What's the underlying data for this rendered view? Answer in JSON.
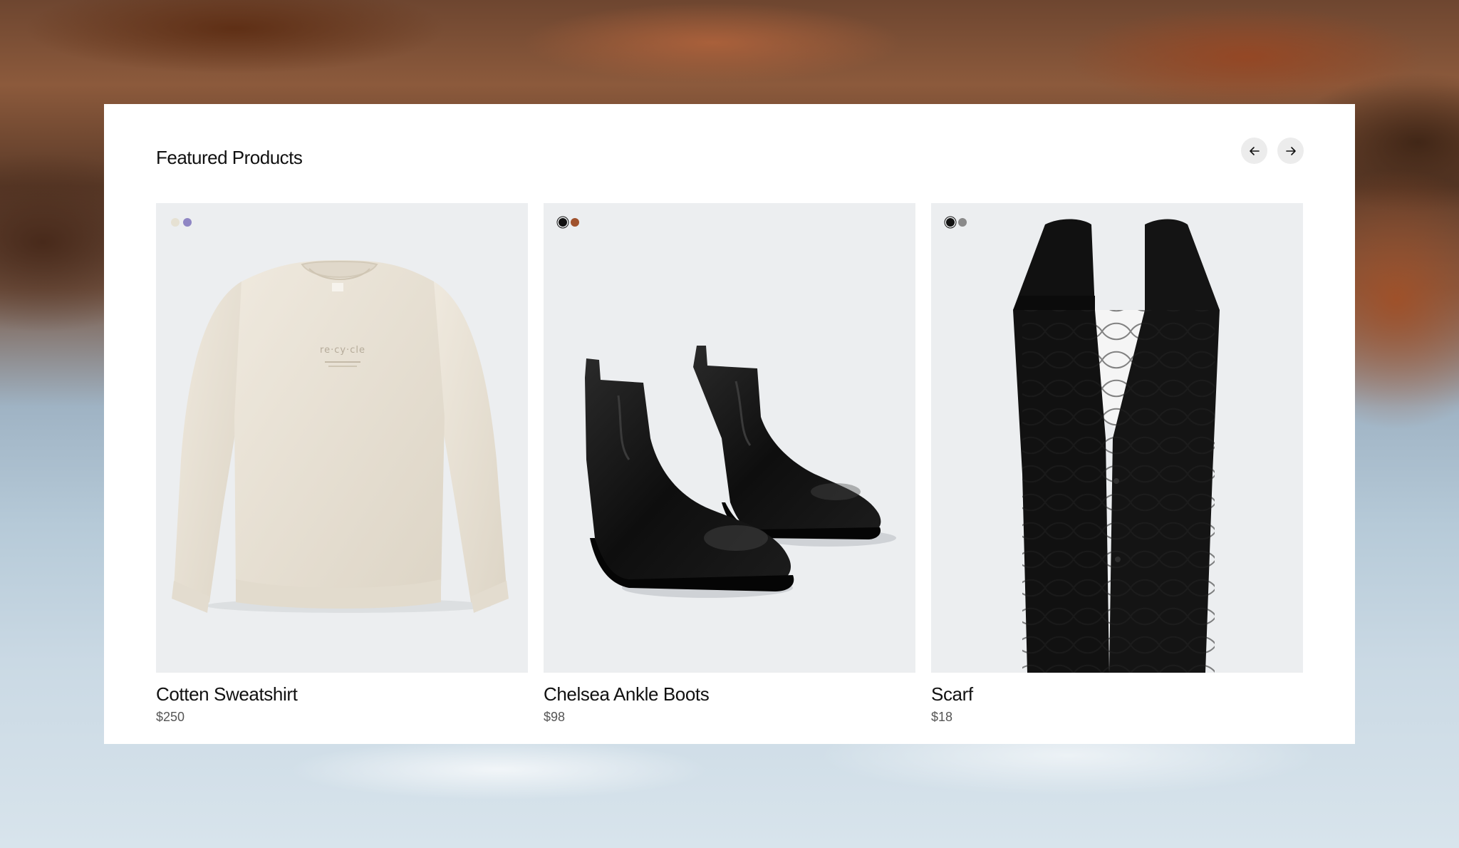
{
  "section": {
    "title": "Featured Products"
  },
  "products": [
    {
      "name": "Cotten Sweatshirt",
      "price": "$250",
      "swatches": [
        {
          "color": "#e6e1d3",
          "selected": false
        },
        {
          "color": "#8f86c4",
          "selected": false
        }
      ],
      "image_icon": "sweatshirt-image",
      "print_text": "re·cy·cle"
    },
    {
      "name": "Chelsea Ankle Boots",
      "price": "$98",
      "swatches": [
        {
          "color": "#111111",
          "selected": true
        },
        {
          "color": "#a0522d",
          "selected": false
        }
      ],
      "image_icon": "boots-image"
    },
    {
      "name": "Scarf",
      "price": "$18",
      "swatches": [
        {
          "color": "#111111",
          "selected": true
        },
        {
          "color": "#8a8a8a",
          "selected": false
        }
      ],
      "image_icon": "scarf-image"
    }
  ],
  "navigation": {
    "prev_icon": "arrow-left-icon",
    "next_icon": "arrow-right-icon"
  }
}
